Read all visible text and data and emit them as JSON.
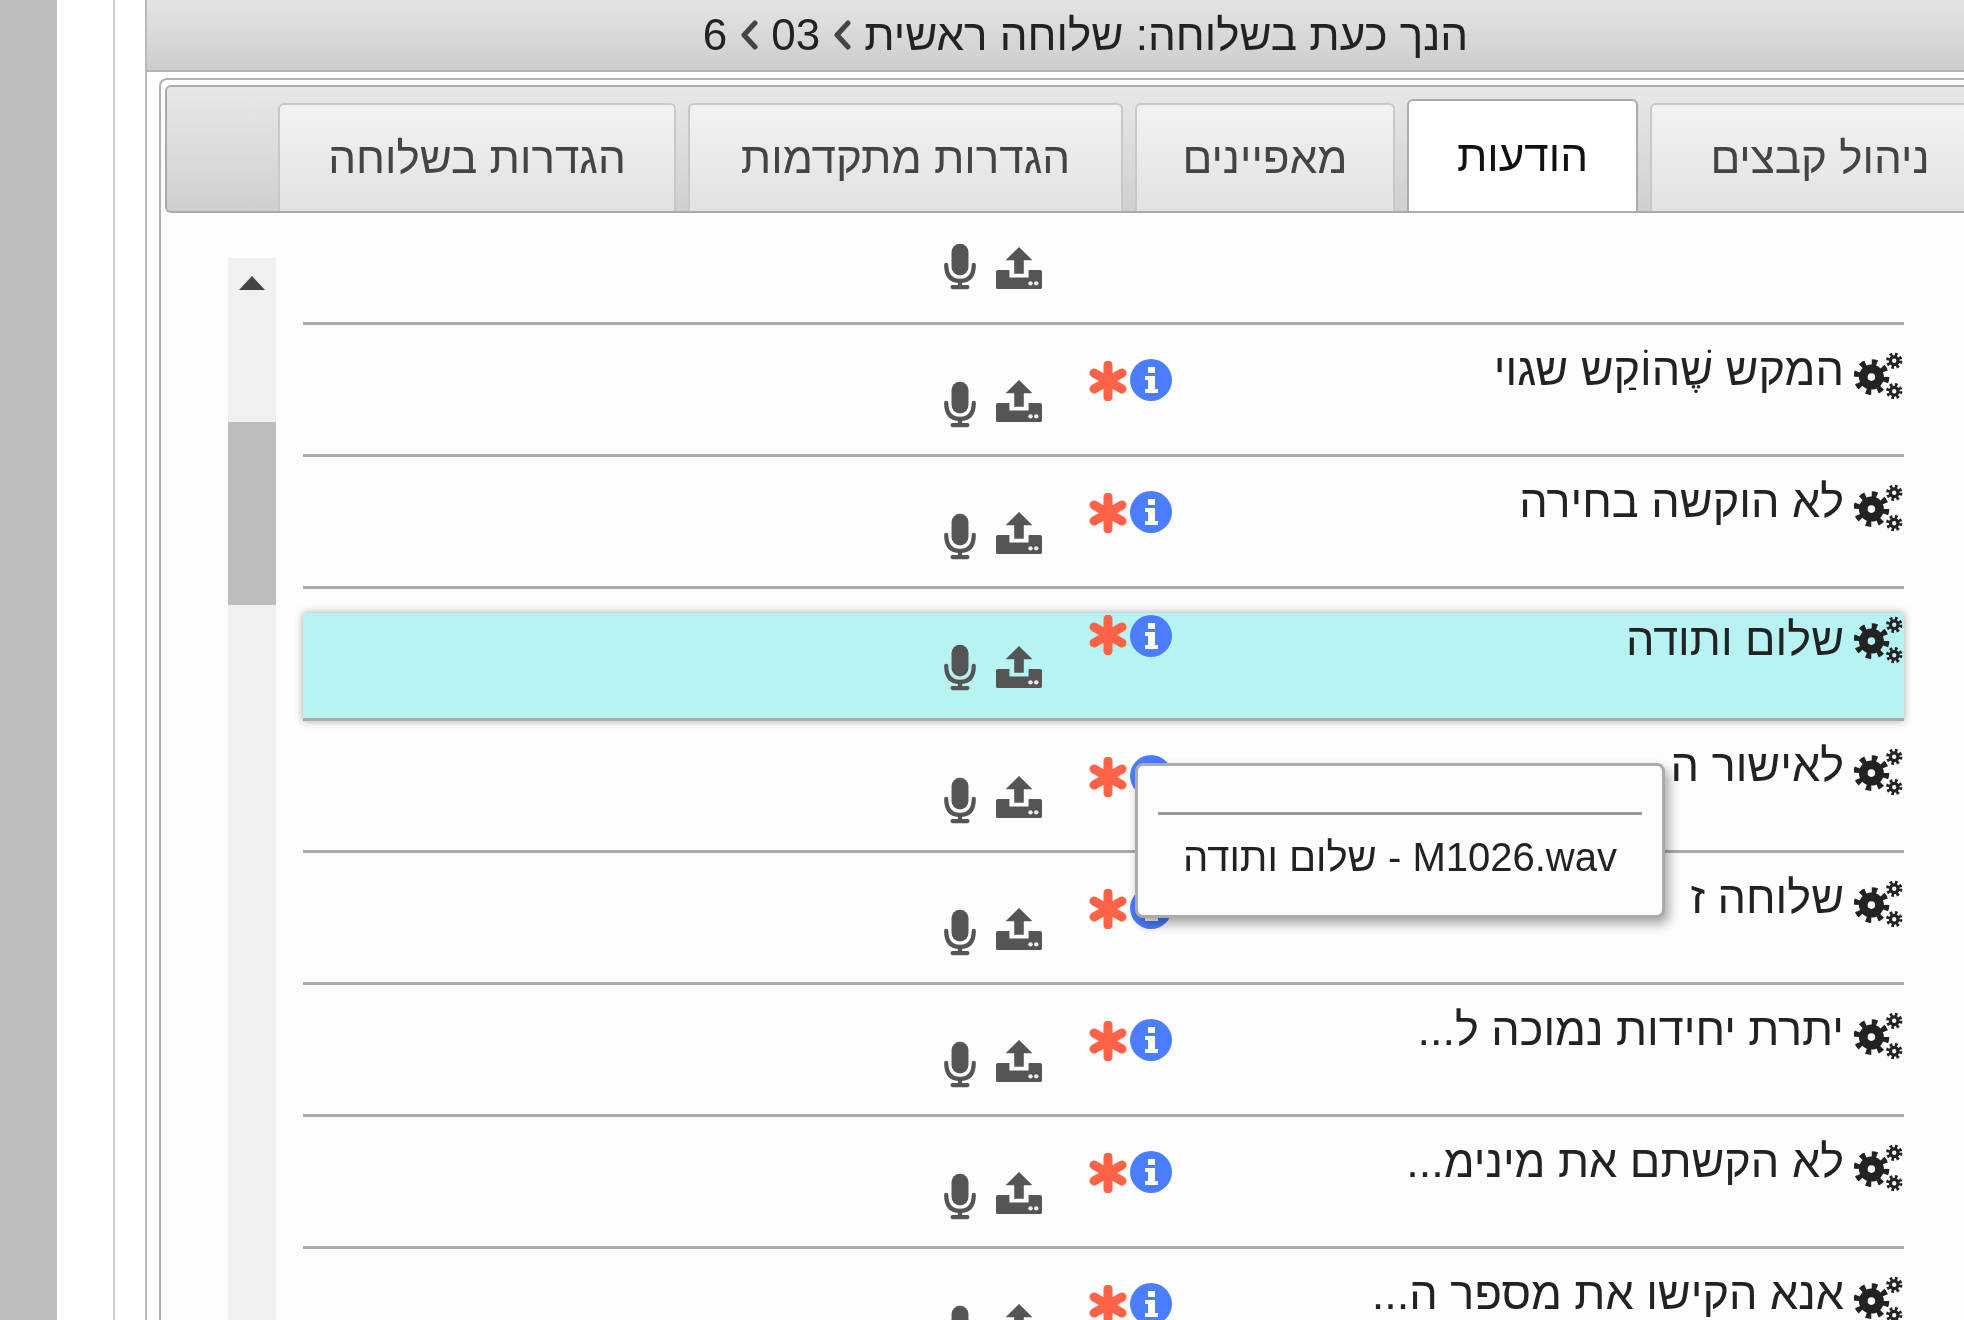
{
  "header": {
    "breadcrumb": [
      "הנך כעת בשלוחה: שלוחה ראשית",
      "03",
      "6"
    ]
  },
  "tabs": [
    {
      "label": "ניהול קבצים",
      "selected": false
    },
    {
      "label": "הודעות",
      "selected": true
    },
    {
      "label": "מאפיינים",
      "selected": false
    },
    {
      "label": "הגדרות מתקדמות",
      "selected": false
    },
    {
      "label": "הגדרות בשלוחה",
      "selected": false
    }
  ],
  "messages": [
    {
      "kind": "clipped",
      "selected": false
    },
    {
      "kind": "full",
      "name": "המקש שֶׁהוֹקַש שגוי",
      "selected": false
    },
    {
      "kind": "full",
      "name": "לא הוקשה בחירה",
      "selected": false
    },
    {
      "kind": "full",
      "name": "שלום ותודה",
      "selected": true
    },
    {
      "kind": "full",
      "name": "לאישור ה",
      "selected": false
    },
    {
      "kind": "full",
      "name": "שלוחה ז",
      "selected": false
    },
    {
      "kind": "full",
      "name": "יתרת יחידות נמוכה ל...",
      "selected": false
    },
    {
      "kind": "full",
      "name": "לא הקשתם את מינימ...",
      "selected": false
    },
    {
      "kind": "full",
      "name": "אנא הקישו את מספר ה...",
      "selected": false
    }
  ],
  "tooltip": {
    "text": "M1026.wav - שלום ותודה"
  }
}
